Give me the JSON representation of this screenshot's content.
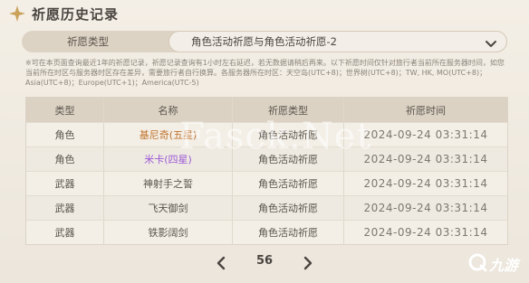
{
  "header": {
    "title": "祈愿历史记录",
    "icon": "sparkle-icon"
  },
  "filter": {
    "label": "祈愿类型",
    "selected": "角色活动祈愿与角色活动祈愿-2"
  },
  "notice": "※可在本页面查询最近1年的祈愿记录，祈愿记录查询有1小时左右延迟，若无数据请稍后再来。以下祈愿时间仅针对旅行者当前所在服务器时间，如您当前所在时区与服务器时区存在差异，需要旅行者自行换算。各服务器所在时区：天空岛(UTC+8)；世界树(UTC+8)；TW, HK, MO(UTC+8)；Asia(UTC+8)；Europe(UTC+1)；America(UTC-5)",
  "table": {
    "headers": [
      "类型",
      "名称",
      "祈愿类型",
      "祈愿时间"
    ],
    "rows": [
      {
        "type": "角色",
        "name": "基尼奇(五星)",
        "wish": "角色活动祈愿",
        "time": "2024-09-24 03:31:14",
        "rarity": "gold"
      },
      {
        "type": "角色",
        "name": "米卡(四星)",
        "wish": "角色活动祈愿",
        "time": "2024-09-24 03:31:14",
        "rarity": "purple"
      },
      {
        "type": "武器",
        "name": "神射手之誓",
        "wish": "角色活动祈愿",
        "time": "2024-09-24 03:31:14",
        "rarity": "normal"
      },
      {
        "type": "武器",
        "name": "飞天御剑",
        "wish": "角色活动祈愿",
        "time": "2024-09-24 03:31:14",
        "rarity": "normal"
      },
      {
        "type": "武器",
        "name": "铁影阔剑",
        "wish": "角色活动祈愿",
        "time": "2024-09-24 03:31:14",
        "rarity": "normal"
      }
    ]
  },
  "pager": {
    "page": "56"
  },
  "watermark": "Fasck.Net",
  "logo": {
    "text": "九游",
    "icon": "jiuyou-logo-icon"
  },
  "colors": {
    "gold": "#c1722a",
    "purple": "#9b59d6",
    "accent": "#c9a15b"
  }
}
